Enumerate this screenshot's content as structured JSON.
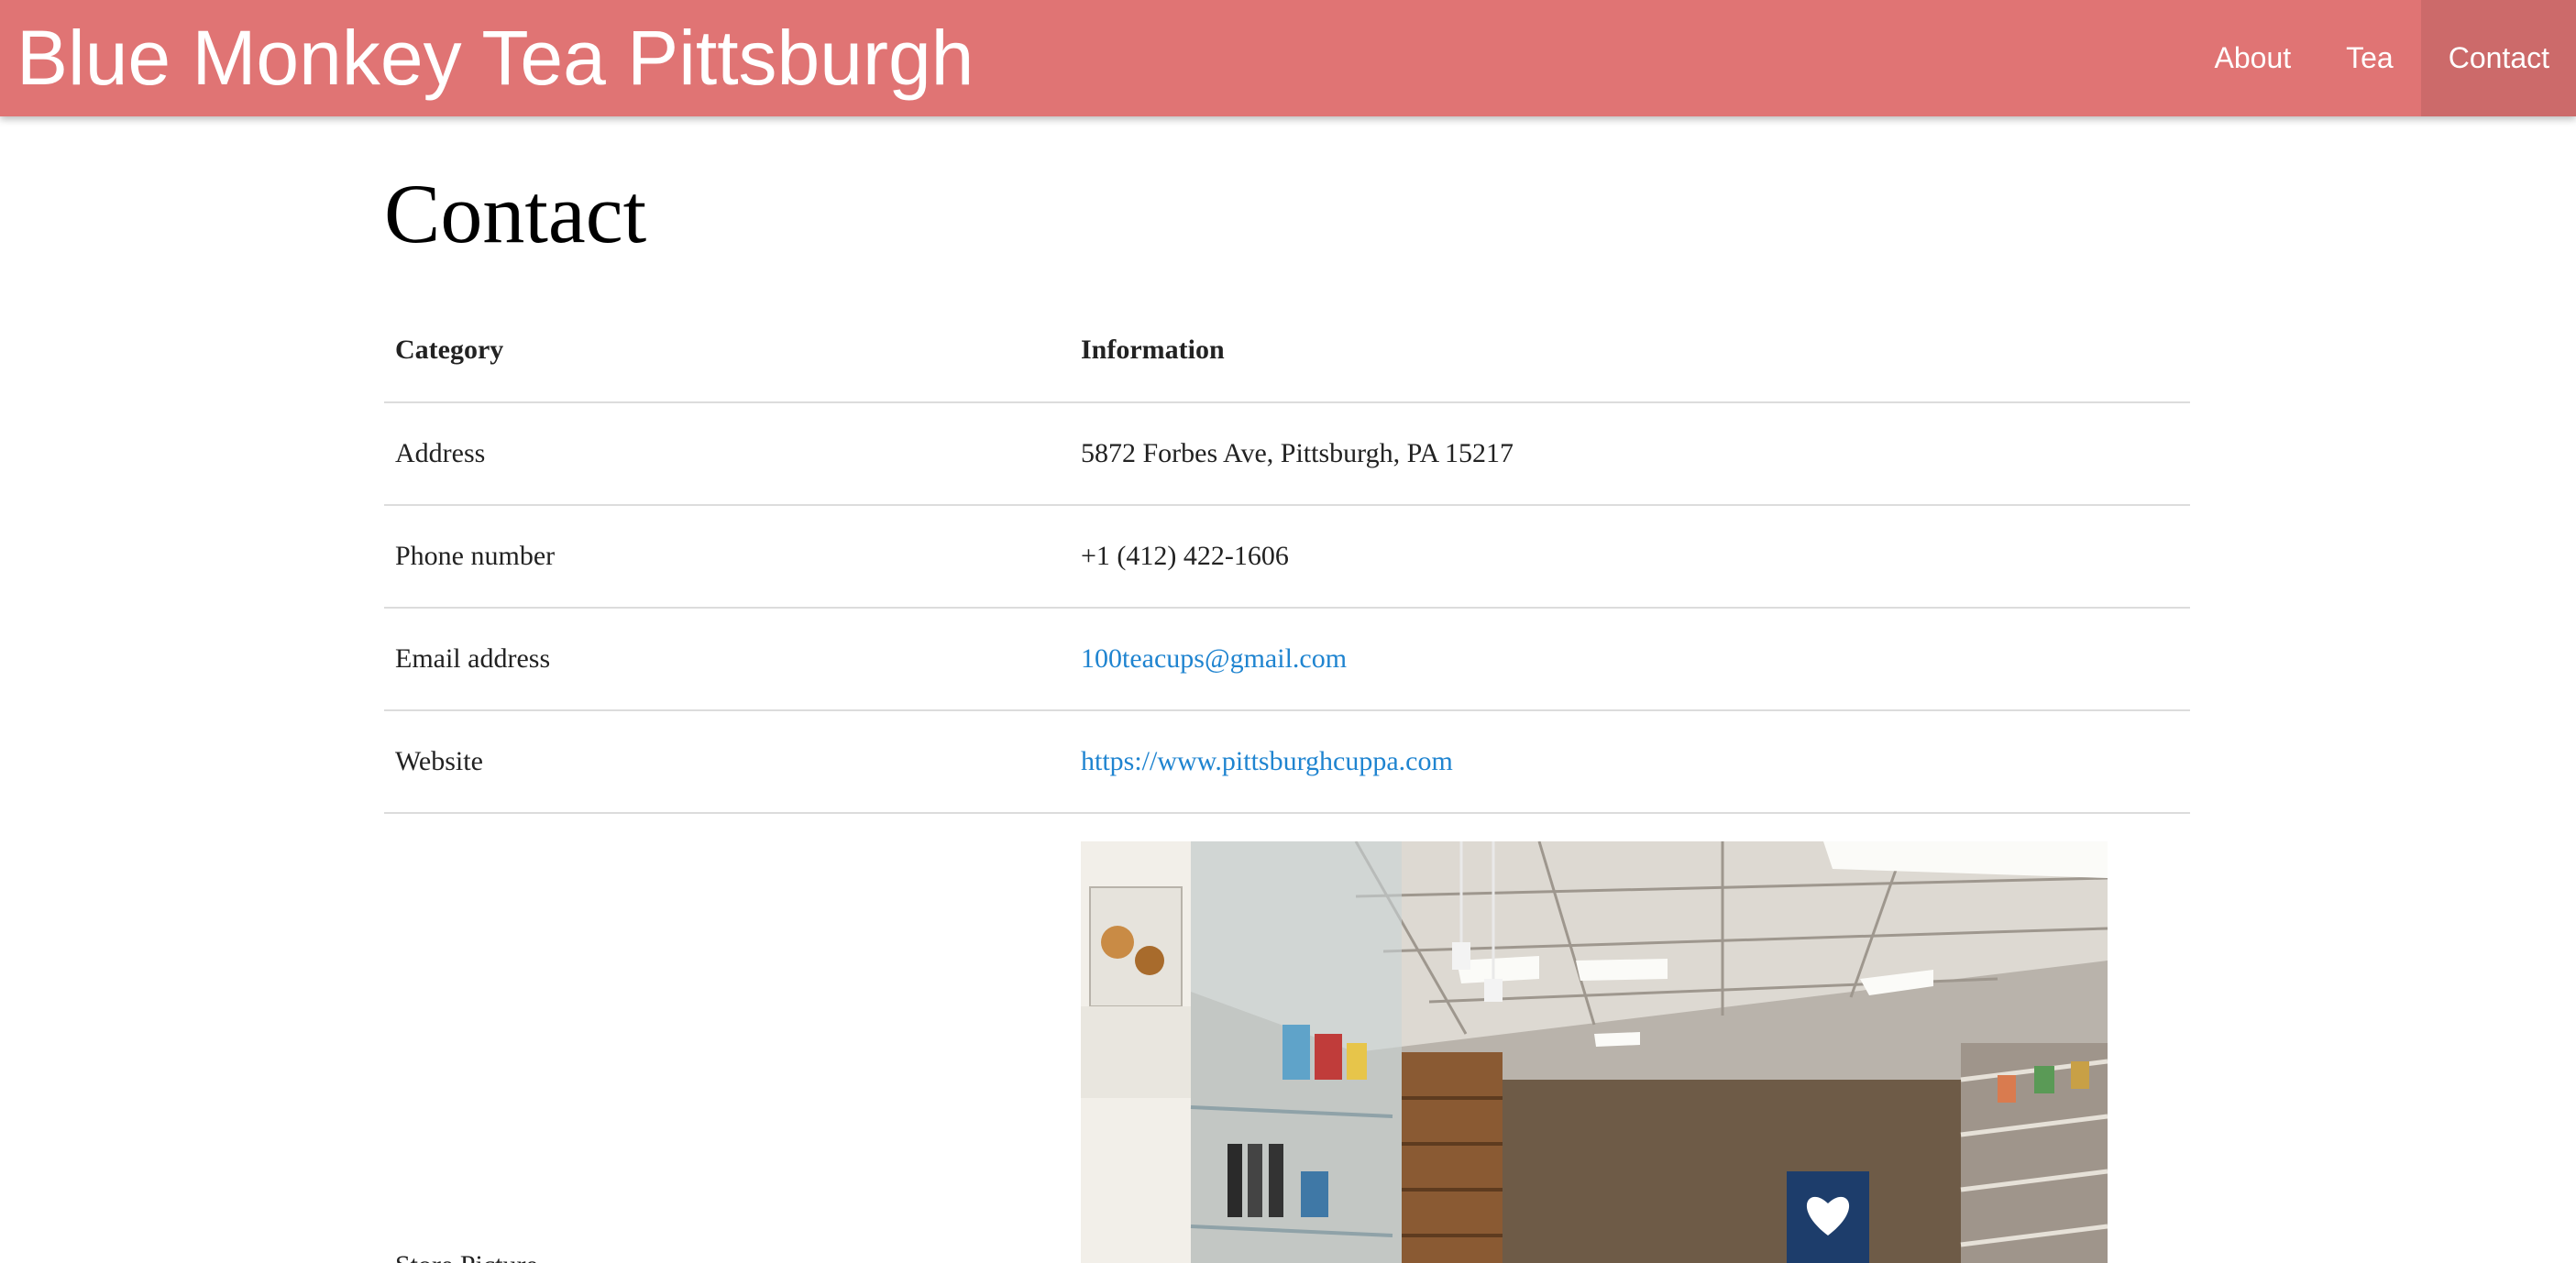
{
  "site": {
    "brand": "Blue Monkey Tea Pittsburgh"
  },
  "nav": {
    "items": [
      {
        "label": "About"
      },
      {
        "label": "Tea"
      },
      {
        "label": "Contact"
      }
    ],
    "active": "Contact"
  },
  "page": {
    "title": "Contact"
  },
  "table": {
    "headers": [
      "Category",
      "Information"
    ],
    "rows": [
      {
        "category": "Address",
        "info": "5872 Forbes Ave, Pittsburgh, PA 15217"
      },
      {
        "category": "Phone number",
        "info": "+1 (412) 422-1606"
      },
      {
        "category": "Email address",
        "info": "100teacups@gmail.com"
      },
      {
        "category": "Website",
        "info": "https://www.pittsburghcuppa.com"
      },
      {
        "category": "Store Picture",
        "info": ""
      }
    ]
  },
  "colors": {
    "navbar": "#e07474",
    "nav_active": "#cc6a6a",
    "link": "#1f84d0"
  }
}
